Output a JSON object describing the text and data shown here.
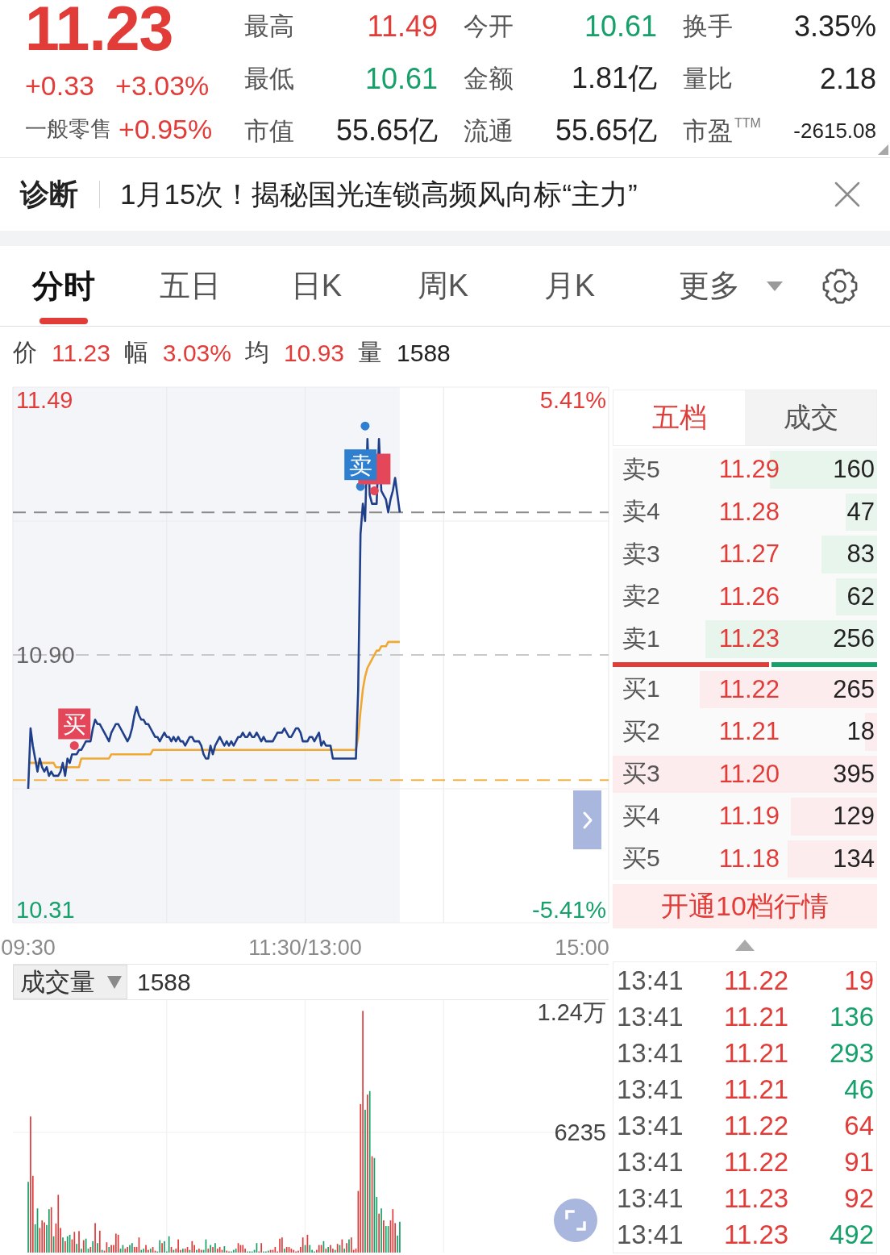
{
  "quote": {
    "price": "11.23",
    "change": "+0.33",
    "change_pct": "+3.03%",
    "sector": "一般零售",
    "sector_change": "+0.95%",
    "stats": [
      {
        "label": "最高",
        "value": "11.49",
        "color": "#e23c39"
      },
      {
        "label": "今开",
        "value": "10.61",
        "color": "#16a06a"
      },
      {
        "label": "换手",
        "value": "3.35%",
        "color": "#222222"
      },
      {
        "label": "最低",
        "value": "10.61",
        "color": "#16a06a"
      },
      {
        "label": "金额",
        "value": "1.81亿",
        "color": "#222222"
      },
      {
        "label": "量比",
        "value": "2.18",
        "color": "#222222"
      },
      {
        "label": "市值",
        "value": "55.65亿",
        "color": "#222222"
      },
      {
        "label": "流通",
        "value": "55.65亿",
        "color": "#222222"
      },
      {
        "label": "市盈",
        "sup": "TTM",
        "value": "-2615.08",
        "color": "#222222"
      }
    ]
  },
  "diagnosis": {
    "label": "诊断",
    "headline": "1月15次！揭秘国光连锁高频风向标“主力”"
  },
  "chart_tabs": [
    {
      "label": "分时",
      "selected": true,
      "kind": "tab"
    },
    {
      "label": "五日",
      "selected": false,
      "kind": "tab"
    },
    {
      "label": "日K",
      "selected": false,
      "kind": "tab"
    },
    {
      "label": "周K",
      "selected": false,
      "kind": "tab"
    },
    {
      "label": "月K",
      "selected": false,
      "kind": "tab"
    },
    {
      "label": "更多",
      "selected": false,
      "kind": "menu"
    }
  ],
  "quote_line": [
    {
      "label": "价",
      "value": "11.23",
      "color": "#e23c39"
    },
    {
      "label": "幅",
      "value": "3.03%",
      "color": "#e23c39"
    },
    {
      "label": "均",
      "value": "10.93",
      "color": "#e23c39"
    },
    {
      "label": "量",
      "value": "1588",
      "color": "#222222"
    }
  ],
  "intraday": {
    "right_axis_labels": [
      {
        "label": "5.41%",
        "color": "#e23c39"
      },
      {
        "label": "-5.41%",
        "color": "#16a06a"
      }
    ],
    "chart_data": {
      "type": "line",
      "categories": [
        "09:30",
        null,
        null,
        null,
        null,
        null,
        null,
        null,
        null,
        null,
        null,
        null,
        null,
        null,
        null,
        null,
        null,
        null,
        null,
        null,
        null,
        null,
        null,
        null,
        null,
        null,
        null,
        null,
        null,
        null,
        null,
        null,
        null,
        null,
        null,
        null,
        null,
        null,
        null,
        null,
        null,
        null,
        null,
        null,
        null,
        null,
        null,
        null,
        null,
        null,
        null,
        null,
        null,
        null,
        null,
        null,
        null,
        null,
        null,
        null,
        null,
        null,
        null,
        null,
        null,
        null,
        null,
        null,
        null,
        null,
        null,
        null,
        null,
        null,
        null,
        null,
        null,
        null,
        null,
        null,
        null,
        null,
        null,
        null,
        null,
        null,
        null,
        null,
        null,
        null,
        null,
        null,
        null,
        null,
        null,
        null,
        null,
        null,
        null,
        null,
        null,
        null,
        null,
        null,
        null,
        null,
        null,
        null,
        null,
        null,
        null,
        null,
        null,
        null,
        null,
        null,
        null,
        null,
        null,
        null,
        "11:30/13:00",
        null,
        null,
        null,
        null,
        null,
        null,
        null,
        null,
        null,
        null,
        null,
        null,
        null,
        null,
        null,
        null,
        null,
        null,
        null,
        null,
        null,
        null,
        null,
        null,
        null,
        null,
        null,
        null,
        null,
        null,
        null,
        null,
        null,
        null,
        null,
        null,
        null,
        null,
        null,
        null,
        null,
        null,
        null,
        null,
        null,
        null,
        null,
        null,
        null,
        null,
        null,
        null,
        null,
        null,
        null,
        null,
        null,
        null,
        null,
        null,
        null,
        null,
        null,
        null,
        null,
        null,
        null,
        null,
        null,
        null,
        null,
        null,
        null,
        null,
        null,
        null,
        null,
        null,
        null,
        null,
        null,
        null,
        null,
        null,
        null,
        null,
        null,
        null,
        null,
        null,
        null,
        null,
        null,
        null,
        null,
        null,
        null,
        null,
        null,
        null,
        null,
        null,
        null,
        null,
        null,
        null,
        null,
        null,
        null,
        null,
        null,
        null,
        null,
        null,
        null,
        null,
        null,
        null,
        null,
        "15:00"
      ],
      "ylim": [
        10.28,
        11.52
      ],
      "yticks": [
        {
          "value": 11.49,
          "label": "11.49"
        },
        {
          "value": 10.9,
          "label": "10.90"
        },
        {
          "value": 10.31,
          "label": "10.31"
        }
      ],
      "series": [
        {
          "color": "#1f3f8a",
          "values": [
            10.59,
            10.73,
            10.69,
            10.66,
            10.63,
            10.66,
            10.64,
            10.63,
            10.64,
            10.62,
            10.63,
            10.62,
            10.62,
            10.62,
            10.63,
            10.65,
            10.62,
            10.66,
            10.65,
            10.67,
            10.67,
            10.67,
            10.68,
            10.68,
            10.69,
            10.7,
            10.7,
            10.7,
            10.73,
            10.75,
            10.74,
            10.74,
            10.73,
            10.72,
            10.71,
            10.7,
            10.72,
            10.73,
            10.74,
            10.74,
            10.73,
            10.72,
            10.71,
            10.7,
            10.71,
            10.73,
            10.76,
            10.78,
            10.76,
            10.75,
            10.75,
            10.74,
            10.74,
            10.73,
            10.72,
            10.71,
            10.71,
            10.7,
            10.71,
            10.72,
            10.71,
            10.71,
            10.7,
            10.71,
            10.7,
            10.71,
            10.7,
            10.7,
            10.69,
            10.7,
            10.71,
            10.71,
            10.7,
            10.7,
            10.7,
            10.69,
            10.67,
            10.66,
            10.66,
            10.69,
            10.67,
            10.69,
            10.7,
            10.71,
            10.7,
            10.69,
            10.7,
            10.69,
            10.7,
            10.69,
            10.7,
            10.71,
            10.71,
            10.72,
            10.71,
            10.71,
            10.72,
            10.71,
            10.71,
            10.72,
            10.71,
            10.7,
            10.71,
            10.7,
            10.7,
            10.7,
            10.7,
            10.71,
            10.72,
            10.72,
            10.72,
            10.73,
            10.72,
            10.71,
            10.71,
            10.72,
            10.73,
            10.73,
            10.72,
            10.7,
            10.7,
            10.7,
            10.71,
            10.71,
            10.7,
            10.71,
            10.72,
            10.69,
            10.7,
            10.69,
            10.69,
            10.69,
            10.66,
            10.66,
            10.66,
            10.66,
            10.66,
            10.66,
            10.66,
            10.66,
            10.66,
            10.66,
            10.66,
            10.82,
            11.18,
            11.25,
            11.21,
            11.4,
            11.27,
            11.25,
            11.25,
            11.25,
            11.4,
            11.28,
            11.27,
            11.26,
            11.23,
            11.26,
            11.28,
            11.31,
            11.27,
            11.23,
            null,
            null,
            null,
            null,
            null,
            null,
            null,
            null,
            null,
            null,
            null,
            null,
            null,
            null,
            null,
            null,
            null,
            null,
            null,
            null,
            null,
            null,
            null,
            null,
            null,
            null,
            null,
            null,
            null,
            null,
            null,
            null,
            null,
            null,
            null,
            null,
            null,
            null,
            null,
            null,
            null,
            null,
            null,
            null,
            null,
            null,
            null,
            null,
            null,
            null,
            null,
            null,
            null,
            null,
            null,
            null,
            null,
            null,
            null,
            null,
            null,
            null,
            null,
            null,
            null,
            null,
            null,
            null,
            null,
            null,
            null,
            null,
            null,
            null,
            null,
            null,
            null,
            null,
            null
          ]
        },
        {
          "color": "#f0a832",
          "values": [
            10.65,
            10.65,
            10.65,
            10.65,
            10.65,
            10.65,
            10.65,
            10.65,
            10.65,
            10.65,
            10.65,
            10.65,
            10.64,
            10.64,
            10.64,
            10.64,
            10.64,
            10.64,
            10.64,
            10.64,
            10.64,
            10.64,
            10.64,
            10.66,
            10.66,
            10.66,
            10.66,
            10.66,
            10.66,
            10.66,
            10.66,
            10.66,
            10.66,
            10.66,
            10.66,
            10.66,
            10.67,
            10.67,
            10.67,
            10.67,
            10.67,
            10.67,
            10.67,
            10.67,
            10.67,
            10.67,
            10.67,
            10.67,
            10.67,
            10.67,
            10.67,
            10.67,
            10.67,
            10.67,
            10.68,
            10.68,
            10.68,
            10.68,
            10.68,
            10.68,
            10.68,
            10.68,
            10.68,
            10.68,
            10.68,
            10.68,
            10.68,
            10.68,
            10.68,
            10.68,
            10.68,
            10.68,
            10.68,
            10.68,
            10.68,
            10.68,
            10.68,
            10.68,
            10.68,
            10.68,
            10.68,
            10.68,
            10.68,
            10.68,
            10.68,
            10.68,
            10.68,
            10.68,
            10.68,
            10.68,
            10.68,
            10.68,
            10.68,
            10.68,
            10.68,
            10.68,
            10.68,
            10.68,
            10.68,
            10.68,
            10.68,
            10.68,
            10.68,
            10.68,
            10.68,
            10.68,
            10.68,
            10.68,
            10.68,
            10.68,
            10.68,
            10.68,
            10.68,
            10.68,
            10.68,
            10.68,
            10.68,
            10.68,
            10.68,
            10.68,
            10.68,
            10.68,
            10.68,
            10.68,
            10.68,
            10.68,
            10.68,
            10.68,
            10.68,
            10.68,
            10.68,
            10.68,
            10.68,
            10.68,
            10.68,
            10.68,
            10.68,
            10.68,
            10.68,
            10.68,
            10.68,
            10.68,
            10.68,
            10.71,
            10.77,
            10.82,
            10.85,
            10.87,
            10.88,
            10.89,
            10.9,
            10.91,
            10.91,
            10.92,
            10.92,
            10.92,
            10.93,
            10.93,
            10.93,
            10.93,
            10.93,
            10.93,
            null,
            null,
            null,
            null,
            null,
            null,
            null,
            null,
            null,
            null,
            null,
            null,
            null,
            null,
            null,
            null,
            null,
            null,
            null,
            null,
            null,
            null,
            null,
            null,
            null,
            null,
            null,
            null,
            null,
            null,
            null,
            null,
            null,
            null,
            null,
            null,
            null,
            null,
            null,
            null,
            null,
            null,
            null,
            null,
            null,
            null,
            null,
            null,
            null,
            null,
            null,
            null,
            null,
            null,
            null,
            null,
            null,
            null,
            null,
            null,
            null,
            null,
            null,
            null,
            null,
            null,
            null,
            null,
            null,
            null,
            null,
            null,
            null,
            null,
            null,
            null,
            null,
            null,
            null
          ]
        },
        {
          "type": "scatter",
          "color": "#e4465a",
          "values": [
            null,
            null,
            null,
            null,
            null,
            null,
            null,
            null,
            null,
            null,
            null,
            null,
            null,
            null,
            null,
            null,
            null,
            null,
            null,
            null,
            10.69,
            null,
            null,
            null,
            null,
            null,
            null,
            null,
            null,
            null,
            null,
            null,
            null,
            null,
            null,
            null,
            null,
            null,
            null,
            null,
            null,
            null,
            null,
            null,
            null,
            null,
            null,
            null,
            null,
            null,
            null,
            null,
            null,
            null,
            null,
            null,
            null,
            null,
            null,
            null,
            null,
            null,
            null,
            null,
            null,
            null,
            null,
            null,
            null,
            null,
            null,
            null,
            null,
            null,
            null,
            null,
            null,
            null,
            null,
            null,
            null,
            null,
            null,
            null,
            null,
            null,
            null,
            null,
            null,
            null,
            null,
            null,
            null,
            null,
            null,
            null,
            null,
            null,
            null,
            null,
            null,
            null,
            null,
            null,
            null,
            null,
            null,
            null,
            null,
            null,
            null,
            null,
            null,
            null,
            null,
            null,
            null,
            null,
            null,
            null,
            null,
            null,
            null,
            null,
            null,
            null,
            null,
            null,
            null,
            null,
            null,
            null,
            null,
            null,
            null,
            null,
            null,
            null,
            null,
            null,
            null,
            null,
            null,
            null,
            null,
            null,
            null,
            null,
            null,
            null,
            11.28,
            null,
            null,
            null,
            null,
            null,
            null,
            null,
            null,
            null,
            null,
            null,
            null,
            null,
            null,
            null,
            null,
            null,
            null,
            null,
            null,
            null,
            null,
            null,
            null,
            null,
            null,
            null,
            null,
            null,
            null,
            null,
            null,
            null,
            null,
            null,
            null,
            null,
            null,
            null,
            null,
            null,
            null,
            null,
            null,
            null,
            null,
            null,
            null,
            null,
            null,
            null,
            null,
            null,
            null,
            null,
            null,
            null,
            null,
            null,
            null,
            null,
            null,
            null,
            null,
            null,
            null,
            null,
            null,
            null,
            null,
            null,
            null,
            null,
            null,
            null,
            null,
            null,
            null,
            null,
            null,
            null,
            null,
            null,
            null,
            null,
            null,
            null,
            null,
            null,
            null
          ]
        },
        {
          "type": "scatter",
          "color": "#2f7fd1",
          "values": [
            null,
            null,
            null,
            null,
            null,
            null,
            null,
            null,
            null,
            null,
            null,
            null,
            null,
            null,
            null,
            null,
            null,
            null,
            null,
            null,
            null,
            null,
            null,
            null,
            null,
            null,
            null,
            null,
            null,
            null,
            null,
            null,
            null,
            null,
            null,
            null,
            null,
            null,
            null,
            null,
            null,
            null,
            null,
            null,
            null,
            null,
            null,
            null,
            null,
            null,
            null,
            null,
            null,
            null,
            null,
            null,
            null,
            null,
            null,
            null,
            null,
            null,
            null,
            null,
            null,
            null,
            null,
            null,
            null,
            null,
            null,
            null,
            null,
            null,
            null,
            null,
            null,
            null,
            null,
            null,
            null,
            null,
            null,
            null,
            null,
            null,
            null,
            null,
            null,
            null,
            null,
            null,
            null,
            null,
            null,
            null,
            null,
            null,
            null,
            null,
            null,
            null,
            null,
            null,
            null,
            null,
            null,
            null,
            null,
            null,
            null,
            null,
            null,
            null,
            null,
            null,
            null,
            null,
            null,
            null,
            null,
            null,
            null,
            null,
            null,
            null,
            null,
            null,
            null,
            null,
            null,
            null,
            null,
            null,
            null,
            null,
            null,
            null,
            null,
            null,
            null,
            null,
            null,
            null,
            11.29,
            null,
            11.43,
            null,
            null,
            null,
            null,
            null,
            null,
            null,
            null,
            null,
            null,
            null,
            null,
            null,
            null,
            null,
            null,
            null,
            null,
            null,
            null,
            null,
            null,
            null,
            null,
            null,
            null,
            null,
            null,
            null,
            null,
            null,
            null,
            null,
            null,
            null,
            null,
            null,
            null,
            null,
            null,
            null,
            null,
            null,
            null,
            null,
            null,
            null,
            null,
            null,
            null,
            null,
            null,
            null,
            null,
            null,
            null,
            null,
            null,
            null,
            null,
            null,
            null,
            null,
            null,
            null,
            null,
            null,
            null,
            null,
            null,
            null,
            null,
            null,
            null,
            null,
            null,
            null,
            null,
            null,
            null,
            null,
            null,
            null,
            null,
            null,
            null,
            null,
            null,
            null,
            null,
            null,
            null,
            null,
            null
          ]
        }
      ],
      "ref_lines": [
        {
          "axis": "y",
          "value": 10.9,
          "color": "#c9c9c9"
        },
        {
          "axis": "y",
          "value": 11.23,
          "color": "#8c8c8c"
        },
        {
          "axis": "y",
          "value": 10.61,
          "color": "#f0b446"
        }
      ],
      "annotations": [
        {
          "text": "买",
          "y": 10.69
        },
        {
          "text": "卖",
          "y": 11.29
        }
      ]
    }
  },
  "order_book": {
    "tabs": [
      {
        "label": "五档",
        "selected": true
      },
      {
        "label": "成交",
        "selected": false
      }
    ],
    "asks": [
      {
        "label": "卖5",
        "price": "11.29",
        "volume": "160",
        "level": 0.405
      },
      {
        "label": "卖4",
        "price": "11.28",
        "volume": "47",
        "level": 0.119
      },
      {
        "label": "卖3",
        "price": "11.27",
        "volume": "83",
        "level": 0.21
      },
      {
        "label": "卖2",
        "price": "11.26",
        "volume": "62",
        "level": 0.157
      },
      {
        "label": "卖1",
        "price": "11.23",
        "volume": "256",
        "level": 0.648
      }
    ],
    "ratio_bar": {
      "level": 0.6
    },
    "bids": [
      {
        "label": "买1",
        "price": "11.22",
        "volume": "265",
        "level": 0.671
      },
      {
        "label": "买2",
        "price": "11.21",
        "volume": "18",
        "level": 0.046
      },
      {
        "label": "买3",
        "price": "11.20",
        "volume": "395",
        "level": 1
      },
      {
        "label": "买4",
        "price": "11.19",
        "volume": "129",
        "level": 0.327
      },
      {
        "label": "买5",
        "price": "11.18",
        "volume": "134",
        "level": 0.339
      }
    ],
    "upgrade_button": "开通10档行情"
  },
  "volume": {
    "indicator": "成交量",
    "value": "1588",
    "axis_labels": [
      "1.24万",
      "6235"
    ]
  },
  "trades": [
    {
      "time": "13:41",
      "price": "11.22",
      "volume": "19",
      "color": "#e23c39"
    },
    {
      "time": "13:41",
      "price": "11.21",
      "volume": "136",
      "color": "#16a06a"
    },
    {
      "time": "13:41",
      "price": "11.21",
      "volume": "293",
      "color": "#16a06a"
    },
    {
      "time": "13:41",
      "price": "11.21",
      "volume": "46",
      "color": "#16a06a"
    },
    {
      "time": "13:41",
      "price": "11.22",
      "volume": "64",
      "color": "#e23c39"
    },
    {
      "time": "13:41",
      "price": "11.22",
      "volume": "91",
      "color": "#e23c39"
    },
    {
      "time": "13:41",
      "price": "11.23",
      "volume": "92",
      "color": "#e23c39"
    },
    {
      "time": "13:41",
      "price": "11.23",
      "volume": "492",
      "color": "#16a06a"
    }
  ]
}
